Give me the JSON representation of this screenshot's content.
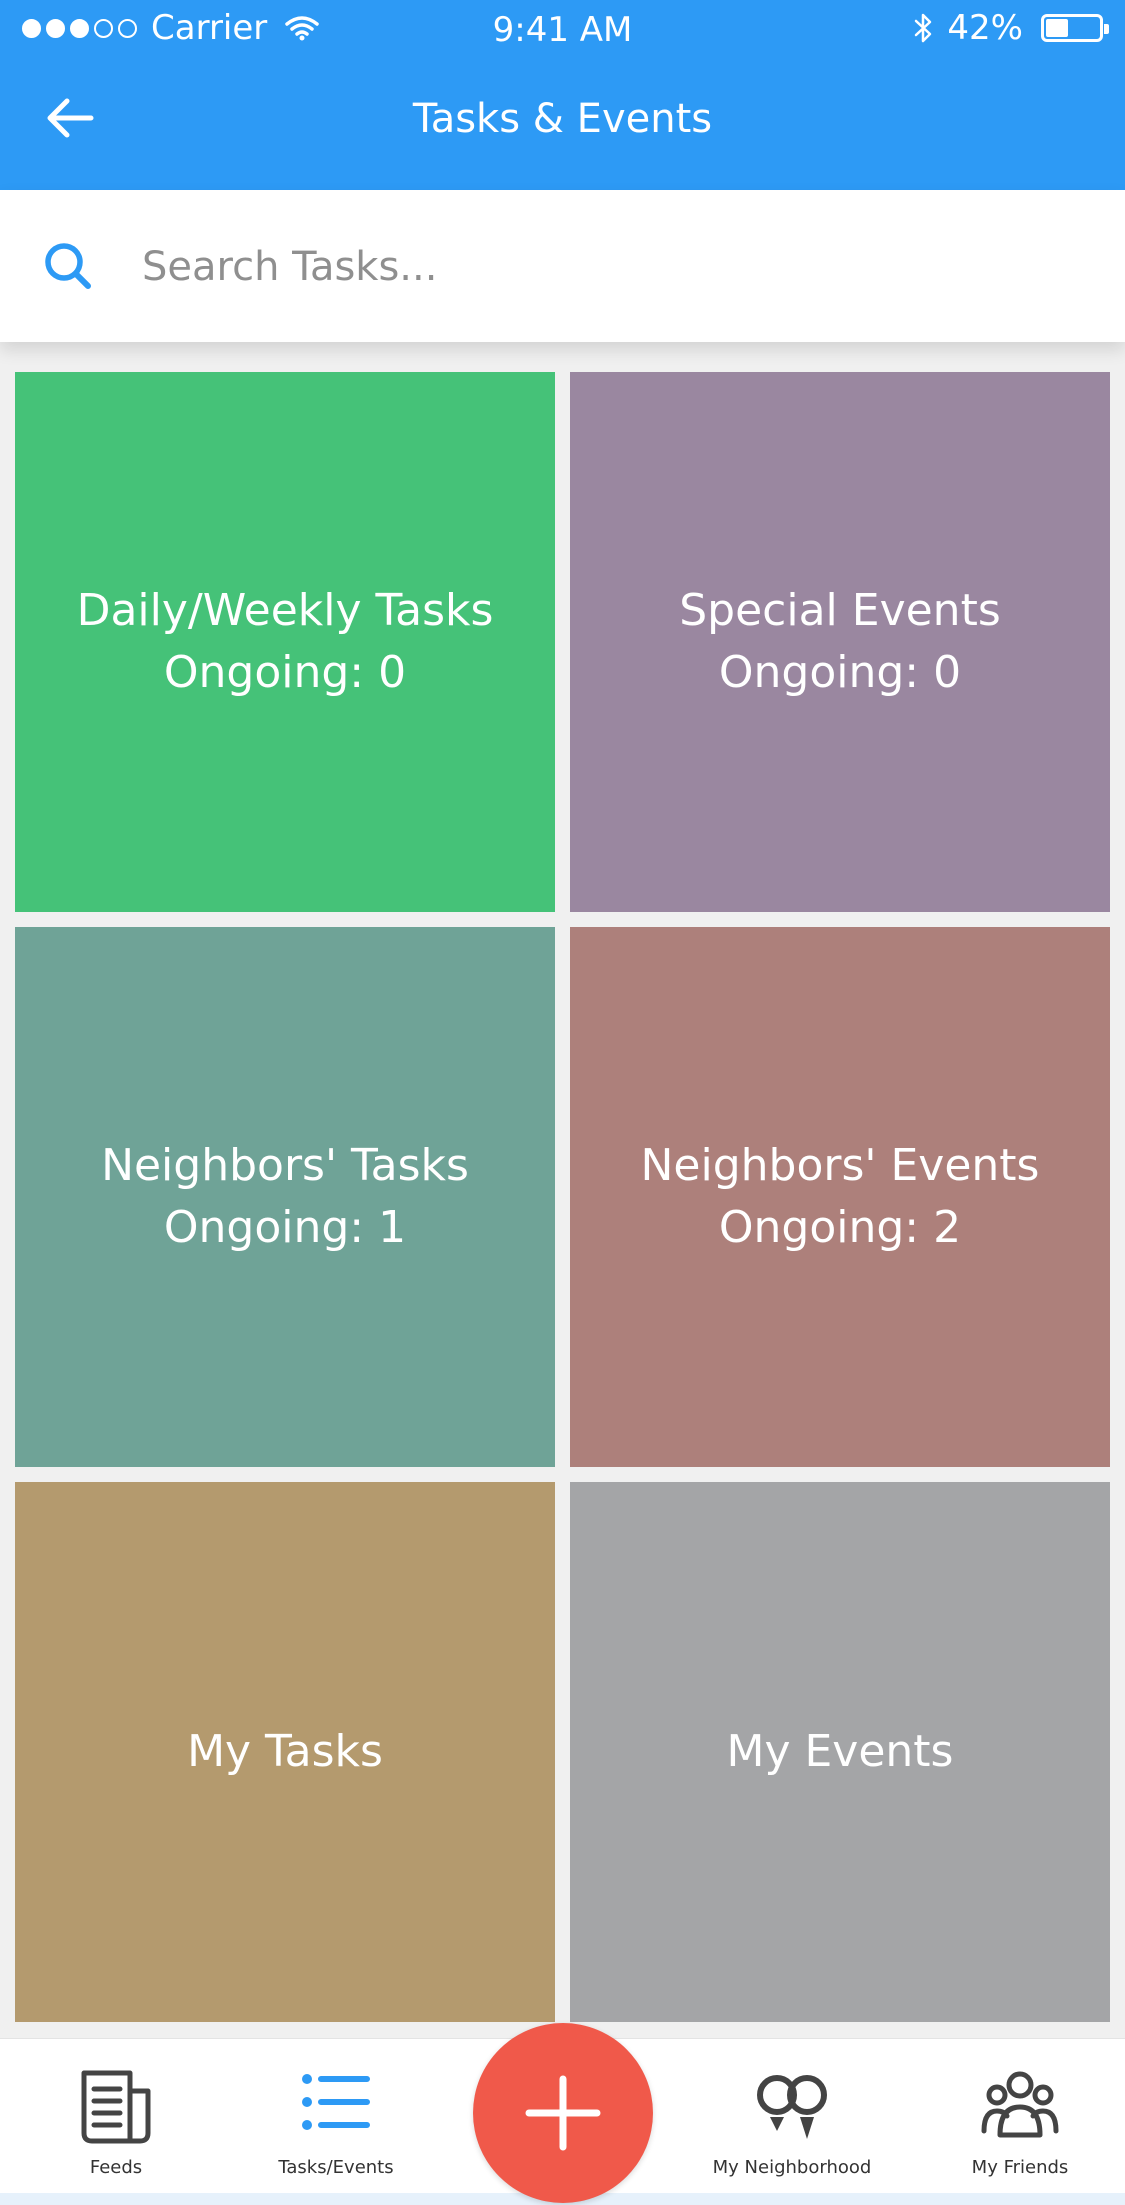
{
  "status_bar": {
    "carrier": "Carrier",
    "time": "9:41 AM",
    "battery": "42%",
    "battery_level": 0.42
  },
  "header": {
    "title": "Tasks & Events",
    "back_icon": "arrow-left-icon"
  },
  "search": {
    "placeholder": "Search Tasks...",
    "value": "",
    "icon": "search-icon"
  },
  "tiles": [
    {
      "title": "Daily/Weekly Tasks",
      "count": "Ongoing: 0",
      "color": "#45c278"
    },
    {
      "title": "Special Events",
      "count": "Ongoing: 0",
      "color": "#9a87a0"
    },
    {
      "title": "Neighbors' Tasks",
      "count": "Ongoing: 1",
      "color": "#6fa397"
    },
    {
      "title": "Neighbors' Events",
      "count": "Ongoing: 2",
      "color": "#ad807b"
    },
    {
      "title": "My Tasks",
      "count": "",
      "color": "#b49a6e"
    },
    {
      "title": "My Events",
      "count": "",
      "color": "#a4a5a7"
    }
  ],
  "tab_bar": {
    "items": [
      {
        "label": "Feeds",
        "icon": "newspaper-icon"
      },
      {
        "label": "Tasks/Events",
        "icon": "list-icon",
        "active": true
      },
      {
        "label": "My Neighborhood",
        "icon": "location-pins-icon"
      },
      {
        "label": "My Friends",
        "icon": "group-icon"
      }
    ],
    "add_icon": "plus-icon"
  },
  "colors": {
    "primary": "#2d9af5",
    "accent": "#f0594a"
  }
}
